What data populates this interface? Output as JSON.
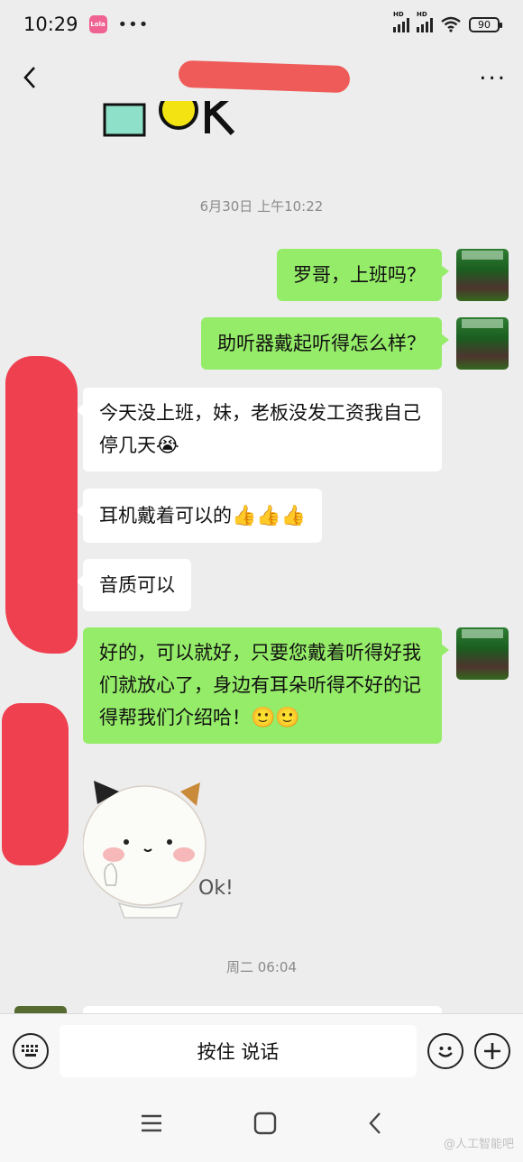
{
  "status_bar": {
    "time": "10:29",
    "battery": "90",
    "signal_label": "HD",
    "icons": [
      "app-badge-icon",
      "more-dots-icon",
      "signal-icon",
      "signal-icon",
      "wifi-icon",
      "battery-icon"
    ]
  },
  "header": {
    "back_icon": "chevron-left-icon",
    "more_icon": "ellipsis-icon"
  },
  "chat": {
    "sticker_top_text": "OK",
    "timestamp_1": "6月30日 上午10:22",
    "messages": [
      {
        "side": "me",
        "text": "罗哥，上班吗？"
      },
      {
        "side": "me",
        "text": "助听器戴起听得怎么样？"
      },
      {
        "side": "other",
        "text": "今天没上班，妹，老板没发工资我自己停几天",
        "emoji": "😭"
      },
      {
        "side": "other",
        "text": "耳机戴着可以的",
        "emoji": "👍👍👍"
      },
      {
        "side": "other",
        "text": "音质可以"
      },
      {
        "side": "me",
        "text": "好的，可以就好，只要您戴着听得好我们就放心了，身边有耳朵听得不好的记得帮我们介绍哈！",
        "emoji": "🙂🙂"
      }
    ],
    "sticker_text": "Ok!",
    "timestamp_2": "周二 06:04"
  },
  "input_bar": {
    "hold_to_talk": "按住 说话",
    "left_icon": "keyboard-icon",
    "emoji_icon": "smiley-icon",
    "plus_icon": "plus-icon"
  },
  "nav_bar": {
    "icons": [
      "menu-icon",
      "home-square-icon",
      "back-triangle-icon"
    ]
  },
  "watermark": "@人工智能吧",
  "colors": {
    "background": "#ededed",
    "my_bubble": "#95ec69",
    "other_bubble": "#ffffff",
    "redaction": "#ef4050"
  }
}
